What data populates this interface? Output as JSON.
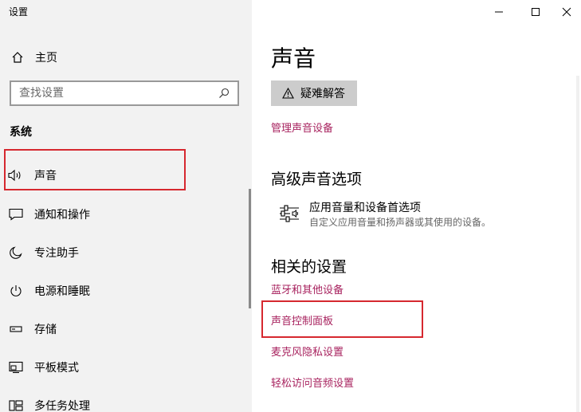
{
  "window": {
    "title": "设置"
  },
  "sidebar": {
    "home_label": "主页",
    "search_placeholder": "查找设置",
    "section_label": "系统",
    "items": [
      {
        "label": "声音",
        "icon": "speaker-icon"
      },
      {
        "label": "通知和操作",
        "icon": "message-icon"
      },
      {
        "label": "专注助手",
        "icon": "moon-icon"
      },
      {
        "label": "电源和睡眠",
        "icon": "power-icon"
      },
      {
        "label": "存储",
        "icon": "storage-icon"
      },
      {
        "label": "平板模式",
        "icon": "tablet-mode-icon"
      },
      {
        "label": "多任务处理",
        "icon": "multitask-icon"
      }
    ]
  },
  "main": {
    "title": "声音",
    "troubleshoot_label": "疑难解答",
    "manage_devices_link": "管理声音设备",
    "advanced_title": "高级声音选项",
    "advanced_item": {
      "title": "应用音量和设备首选项",
      "description": "自定义应用音量和扬声器或其使用的设备。"
    },
    "related_title": "相关的设置",
    "related_links": [
      "蓝牙和其他设备",
      "声音控制面板",
      "麦克风隐私设置",
      "轻松访问音频设置"
    ]
  },
  "colors": {
    "link": "#a8235f",
    "highlight": "#d6282f",
    "sidebar_bg": "#f2f2f2"
  }
}
